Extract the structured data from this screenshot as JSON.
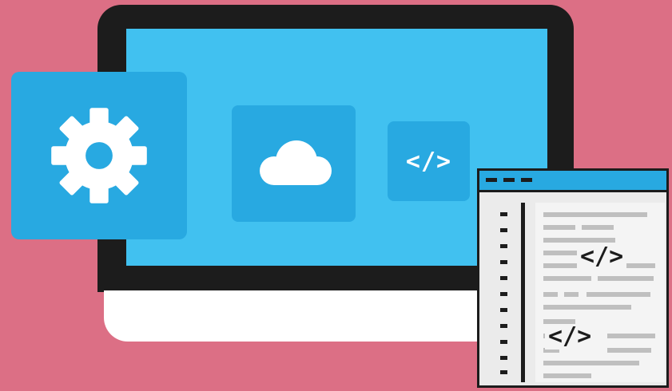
{
  "colors": {
    "background": "#dc6f85",
    "monitor_frame": "#1c1c1c",
    "screen": "#41c1f0",
    "tile": "#28a9e1",
    "editor_bg": "#ebebeb"
  },
  "icons": {
    "settings": "gear-icon",
    "cloud": "cloud-icon",
    "code": "code-icon"
  },
  "code_tile": {
    "glyph": "</>"
  },
  "editor": {
    "glyph_1": "</>",
    "glyph_2": "</>"
  }
}
